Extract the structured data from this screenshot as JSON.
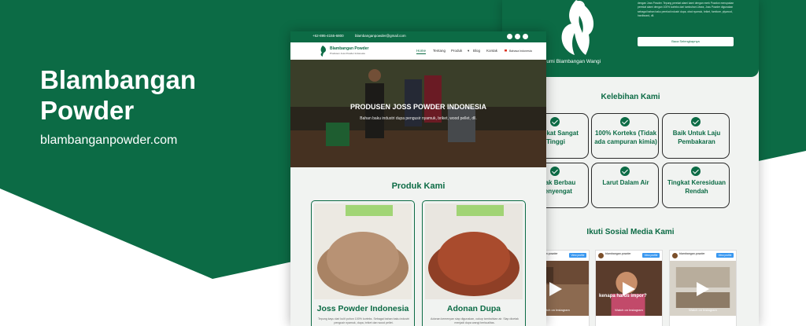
{
  "banner": {
    "title": "Blambangan Powder",
    "url": "blambanganpowder.com"
  },
  "colors": {
    "brand_green": "#0c6b45",
    "page_bg": "#f1f3f1"
  },
  "site_preview": {
    "topbar": {
      "phone": "+62-895-4155-6800",
      "email": "blambanganpowder@gmail.com",
      "social_icons": [
        "facebook-icon",
        "instagram-icon",
        "tiktok-icon"
      ]
    },
    "nav": {
      "logo_name": "Blambangan Powder",
      "logo_tagline": "Produsen Joss Powder Indonesia",
      "menu": [
        "Home",
        "Tentang",
        "Produk",
        "Blog",
        "Kontak"
      ],
      "active_menu": "Home",
      "language": "Bahasa Indonesia"
    },
    "hero": {
      "title": "PRODUSEN JOSS POWDER INDONESIA",
      "subtitle": "Bahan baku industri dupa pengusir nyamuk, briket, wood pellet, dll."
    },
    "products_title": "Produk Kami",
    "products": [
      {
        "name": "Joss Powder Indonesia",
        "description": "Tepung kayu dari kulit pohon 100% korteks. Sebagai bahan baku industri pengusir nyamuk, dupa, briket dan wood pellet."
      },
      {
        "name": "Adonan Dupa",
        "description": "Adonan kemenyan siap digunakan, cukup tambahkan air. Siap dicetak menjadi dupa wangi berkualitas."
      }
    ]
  },
  "site_preview_2": {
    "brand": "Bumi Blambangan Wangi",
    "about": "dengan Joss Powder. Tepung perekat alami kami dengan merk Powdon merupakan perekat alami dengan 100% korteks dari tumbuhan Litsea, Joss Powder digunakan sebagai bahan baku perekat industri dupa, obat nyamuk, briket, furniture, plywood, hardboard, dll.",
    "about_button": "Baca Selengkapnya",
    "advantages_title": "Kelebihan Kami",
    "advantages": [
      "Perekat Sangat Tinggi",
      "100% Korteks (Tidak ada campuran kimia)",
      "Baik Untuk Laju Pembakaran",
      "Tidak Berbau Menyengat",
      "Larut Dalam Air",
      "Tingkat Keresiduan Rendah"
    ],
    "social_title": "Ikuti Sosial Media Kami",
    "instagram_posts": [
      {
        "account": "blambangan.powder",
        "view_profile": "View profile",
        "watch": "Watch on Instagram",
        "caption": ""
      },
      {
        "account": "blambangan.powder",
        "view_profile": "View profile",
        "watch": "Watch on Instagram",
        "caption": "kenapa harus impor?"
      },
      {
        "account": "blambangan.powder",
        "view_profile": "View profile",
        "watch": "Watch on Instagram",
        "caption": ""
      }
    ]
  }
}
